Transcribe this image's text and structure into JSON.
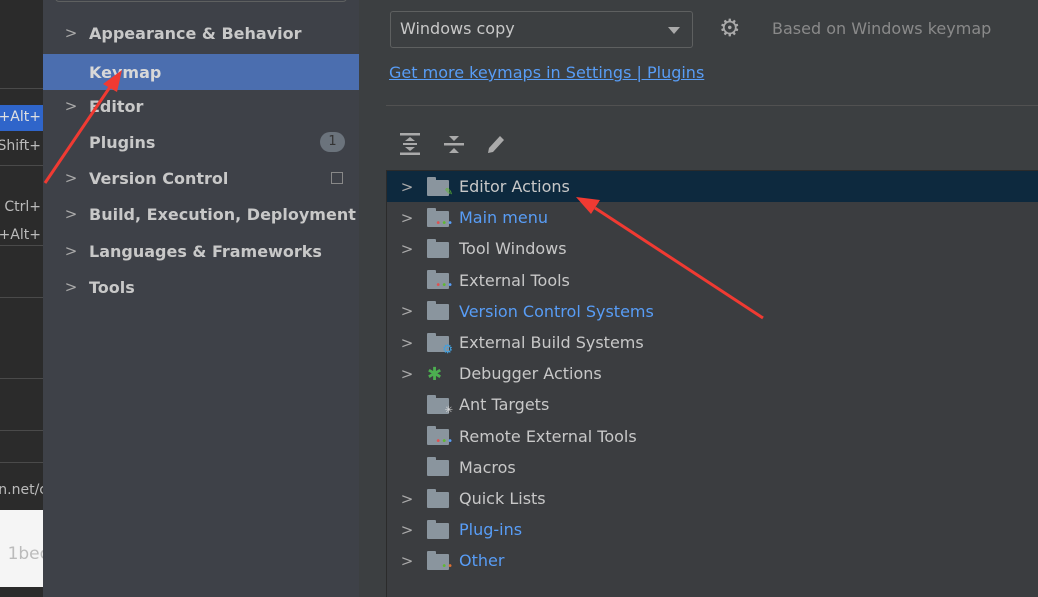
{
  "background_panel": {
    "texts": [
      "+Alt+",
      "Shift+",
      "Ctrl+",
      "+Alt+",
      "ln.net/c",
      "1bec"
    ]
  },
  "sidebar": {
    "items": [
      {
        "label": "Appearance & Behavior",
        "expandable": true
      },
      {
        "label": "Keymap",
        "expandable": false,
        "selected": true
      },
      {
        "label": "Editor",
        "expandable": true
      },
      {
        "label": "Plugins",
        "expandable": false,
        "badge": "1"
      },
      {
        "label": "Version Control",
        "expandable": true
      },
      {
        "label": "Build, Execution, Deployment",
        "expandable": true
      },
      {
        "label": "Languages & Frameworks",
        "expandable": true
      },
      {
        "label": "Tools",
        "expandable": true
      }
    ]
  },
  "keymap": {
    "selected": "Windows copy",
    "based_on": "Based on Windows keymap",
    "more_link": "Get more keymaps in Settings | Plugins"
  },
  "toolbar": {
    "icons": [
      "expand-all-icon",
      "collapse-all-icon",
      "edit-icon"
    ]
  },
  "tree": {
    "items": [
      {
        "label": "Editor Actions",
        "expandable": true,
        "selected": true,
        "icon": "folder-edit"
      },
      {
        "label": "Main menu",
        "expandable": true,
        "modified": true,
        "icon": "folder-menu"
      },
      {
        "label": "Tool Windows",
        "expandable": true,
        "icon": "folder"
      },
      {
        "label": "External Tools",
        "expandable": false,
        "icon": "folder-tools"
      },
      {
        "label": "Version Control Systems",
        "expandable": true,
        "modified": true,
        "icon": "folder"
      },
      {
        "label": "External Build Systems",
        "expandable": true,
        "icon": "folder-gear"
      },
      {
        "label": "Debugger Actions",
        "expandable": true,
        "icon": "bug"
      },
      {
        "label": "Ant Targets",
        "expandable": false,
        "icon": "folder-ant"
      },
      {
        "label": "Remote External Tools",
        "expandable": false,
        "icon": "folder-tools"
      },
      {
        "label": "Macros",
        "expandable": false,
        "icon": "folder"
      },
      {
        "label": "Quick Lists",
        "expandable": true,
        "icon": "folder"
      },
      {
        "label": "Plug-ins",
        "expandable": true,
        "modified": true,
        "icon": "folder"
      },
      {
        "label": "Other",
        "expandable": true,
        "modified": true,
        "icon": "folder-other"
      }
    ]
  },
  "colors": {
    "accent": "#4b6eaf",
    "link": "#589df6",
    "selected_row": "#0d293e",
    "annotation_arrow": "#f03a32"
  }
}
